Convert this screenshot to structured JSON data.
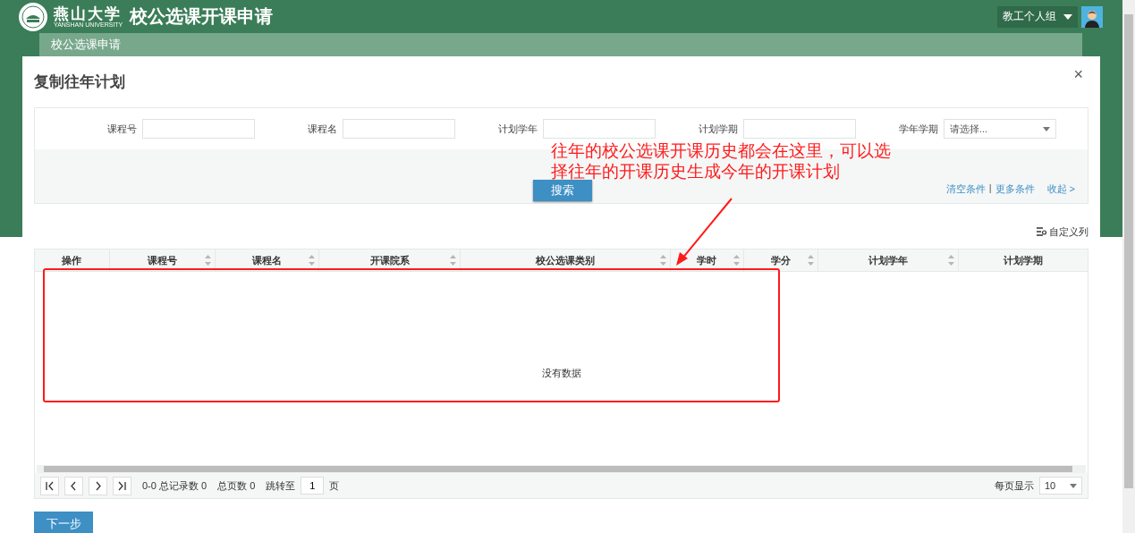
{
  "header": {
    "logo_text": "燕山大学",
    "logo_subtext": "YANSHAN UNIVERSITY",
    "title": "校公选课开课申请",
    "user_menu": "教工个人组"
  },
  "breadcrumb": "校公选课申请",
  "dialog": {
    "title": "复制往年计划",
    "close": "×",
    "search": {
      "fields": [
        {
          "label": "课程号",
          "kind": "text"
        },
        {
          "label": "课程名",
          "kind": "text"
        },
        {
          "label": "计划学年",
          "kind": "text"
        },
        {
          "label": "计划学期",
          "kind": "text"
        },
        {
          "label": "学年学期",
          "kind": "select",
          "placeholder": "请选择..."
        }
      ],
      "button": "搜索",
      "links": [
        "清空条件",
        "更多条件"
      ],
      "separator": "|",
      "collapse": "收起 >"
    },
    "custom_columns": "自定义列",
    "table": {
      "columns": [
        {
          "label": "操作",
          "sortable": false
        },
        {
          "label": "课程号",
          "sortable": true
        },
        {
          "label": "课程名",
          "sortable": true
        },
        {
          "label": "开课院系",
          "sortable": true
        },
        {
          "label": "校公选课类别",
          "sortable": true
        },
        {
          "label": "学时",
          "sortable": true
        },
        {
          "label": "学分",
          "sortable": true
        },
        {
          "label": "计划学年",
          "sortable": true
        },
        {
          "label": "计划学期",
          "sortable": false
        }
      ],
      "empty_text": "没有数据"
    },
    "pager": {
      "summary": "0-0 总记录数 0",
      "pages": "总页数 0",
      "jump_label": "跳转至",
      "page_value": "1",
      "page_unit": "页",
      "page_size_label": "每页显示",
      "page_size": "10"
    },
    "next_button": "下一步"
  },
  "annotation": {
    "lines": [
      "往年的校公选课开课历史都会在这里，可以选",
      "择往年的开课历史生成今年的开课计划"
    ]
  }
}
